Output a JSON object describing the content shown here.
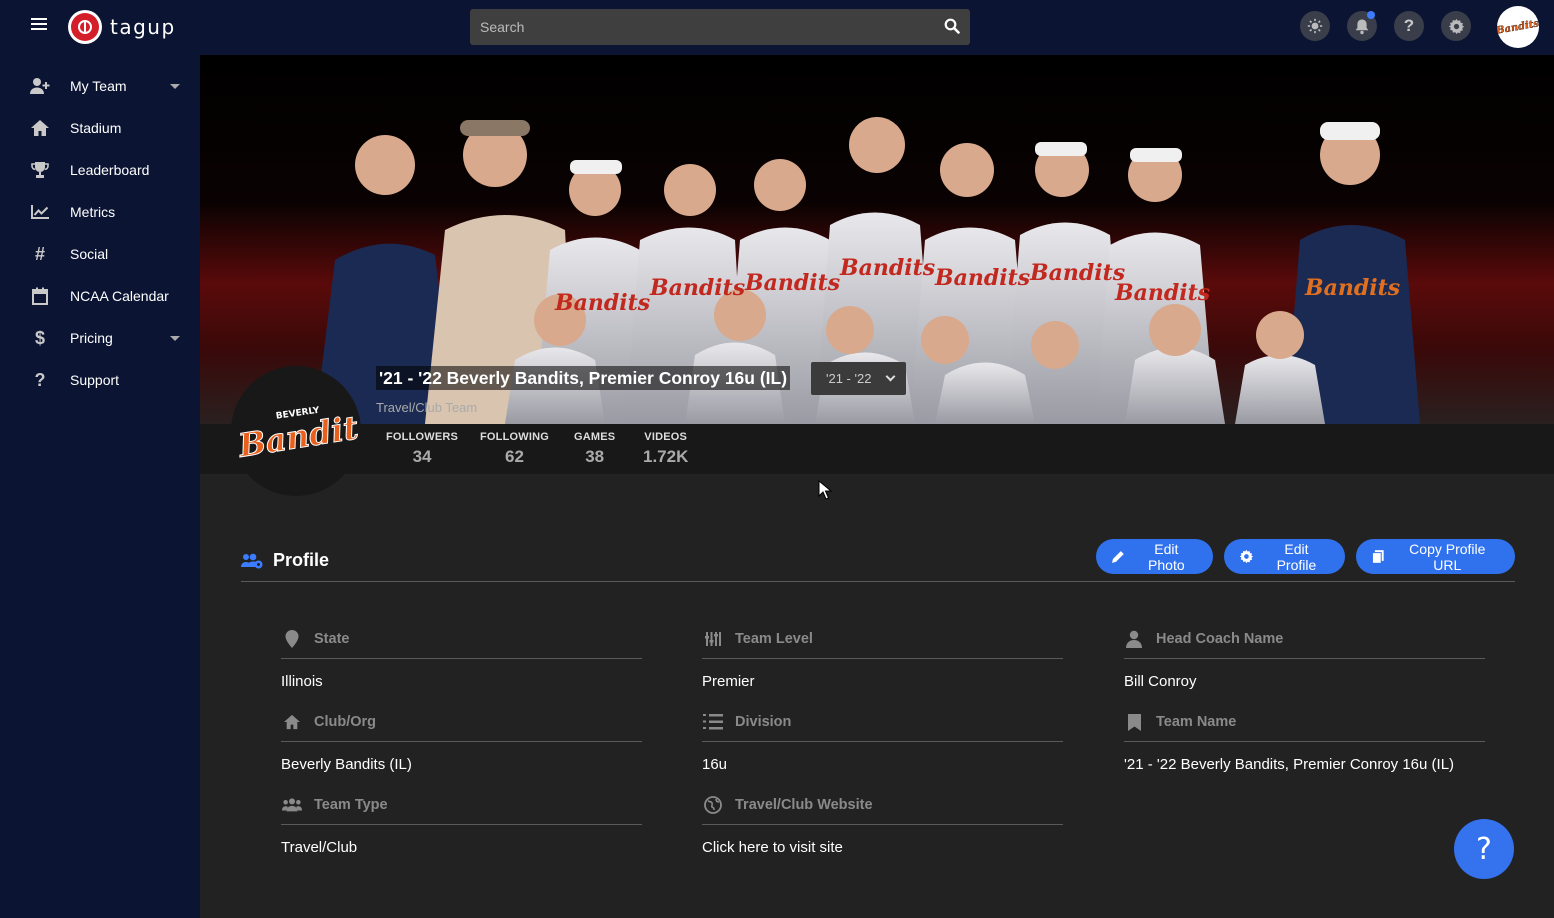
{
  "app": {
    "name": "tagup",
    "brand_color": "#d41f2b",
    "accent_color": "#3072ee"
  },
  "topbar": {
    "search_placeholder": "Search",
    "icons": [
      "brightness-icon",
      "bell-icon",
      "help-icon",
      "gear-icon"
    ],
    "user_avatar_text": "Bandits"
  },
  "sidebar": {
    "items": [
      {
        "label": "My Team",
        "icon": "add-user-icon",
        "has_caret": true
      },
      {
        "label": "Stadium",
        "icon": "home-icon",
        "has_caret": false
      },
      {
        "label": "Leaderboard",
        "icon": "trophy-icon",
        "has_caret": false
      },
      {
        "label": "Metrics",
        "icon": "line-chart-icon",
        "has_caret": false
      },
      {
        "label": "Social",
        "icon": "hashtag-icon",
        "has_caret": false
      },
      {
        "label": "NCAA Calendar",
        "icon": "calendar-icon",
        "has_caret": false
      },
      {
        "label": "Pricing",
        "icon": "dollar-icon",
        "has_caret": true
      },
      {
        "label": "Support",
        "icon": "question-icon",
        "has_caret": false
      }
    ]
  },
  "team": {
    "title": "'21 - '22 Beverly Bandits, Premier Conroy 16u (IL)",
    "season": "'21 - '22",
    "subtitle": "Travel/Club Team",
    "logo_text_top": "BEVERLY",
    "logo_text_main": "Bandits"
  },
  "stats": [
    {
      "label": "FOLLOWERS",
      "value": "34"
    },
    {
      "label": "FOLLOWING",
      "value": "62"
    },
    {
      "label": "GAMES",
      "value": "38"
    },
    {
      "label": "VIDEOS",
      "value": "1.72K"
    }
  ],
  "profile": {
    "title": "Profile",
    "buttons": {
      "edit_photo": "Edit Photo",
      "edit_profile": "Edit Profile",
      "copy_url": "Copy Profile URL"
    },
    "fields": [
      {
        "label": "State",
        "value": "Illinois",
        "icon": "map-pin-icon"
      },
      {
        "label": "Team Level",
        "value": "Premier",
        "icon": "sliders-icon"
      },
      {
        "label": "Head Coach Name",
        "value": "Bill Conroy",
        "icon": "user-icon"
      },
      {
        "label": "Club/Org",
        "value": "Beverly Bandits (IL)",
        "icon": "home-icon"
      },
      {
        "label": "Division",
        "value": "16u",
        "icon": "list-icon"
      },
      {
        "label": "Team Name",
        "value": "'21 - '22 Beverly Bandits, Premier Conroy 16u (IL)",
        "icon": "bookmark-icon"
      },
      {
        "label": "Team Type",
        "value": "Travel/Club",
        "icon": "users-icon"
      },
      {
        "label": "Travel/Club Website",
        "value": "Click here to visit site",
        "icon": "globe-icon"
      }
    ]
  },
  "help_fab": {
    "label": "?"
  }
}
